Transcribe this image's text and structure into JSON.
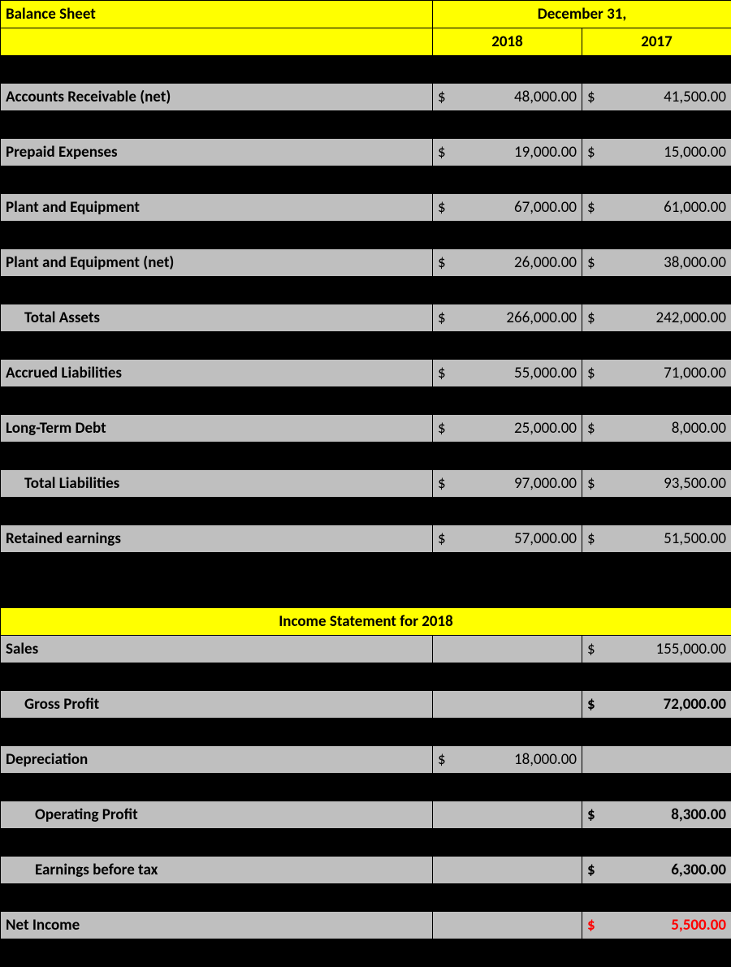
{
  "currency_symbol": "$",
  "balance_sheet": {
    "title": "Balance Sheet",
    "period_header": "December 31,",
    "year1": "2018",
    "year2": "2017",
    "rows": {
      "accounts_receivable": {
        "label": "Accounts Receivable (net)",
        "y1": "48,000.00",
        "y2": "41,500.00"
      },
      "prepaid_expenses": {
        "label": "Prepaid Expenses",
        "y1": "19,000.00",
        "y2": "15,000.00"
      },
      "plant_equipment": {
        "label": "Plant and Equipment",
        "y1": "67,000.00",
        "y2": "61,000.00"
      },
      "plant_equipment_net": {
        "label": "Plant and Equipment (net)",
        "y1": "26,000.00",
        "y2": "38,000.00"
      },
      "total_assets": {
        "label": "Total Assets",
        "y1": "266,000.00",
        "y2": "242,000.00"
      },
      "accrued_liabilities": {
        "label": "Accrued Liabilities",
        "y1": "55,000.00",
        "y2": "71,000.00"
      },
      "long_term_debt": {
        "label": "Long-Term Debt",
        "y1": "25,000.00",
        "y2": "8,000.00"
      },
      "total_liabilities": {
        "label": "Total Liabilities",
        "y1": "97,000.00",
        "y2": "93,500.00"
      },
      "retained_earnings": {
        "label": "Retained earnings",
        "y1": "57,000.00",
        "y2": "51,500.00"
      }
    }
  },
  "income_statement": {
    "title": "Income Statement for 2018",
    "rows": {
      "sales": {
        "label": "Sales",
        "val": "155,000.00"
      },
      "gross_profit": {
        "label": "Gross Profit",
        "val": "72,000.00"
      },
      "depreciation": {
        "label": "Depreciation",
        "val": "18,000.00"
      },
      "op_profit": {
        "label": "Operating Profit",
        "val": "8,300.00"
      },
      "ebt": {
        "label": "Earnings before tax",
        "val": "6,300.00"
      },
      "net_income": {
        "label": "Net Income",
        "val": "5,500.00"
      }
    }
  }
}
